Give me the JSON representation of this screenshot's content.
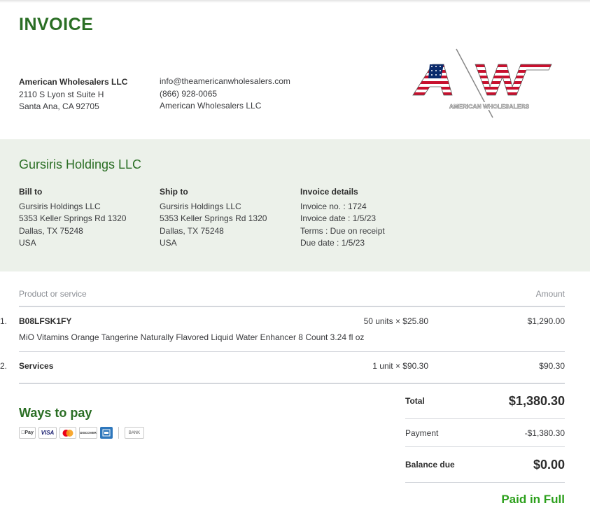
{
  "document": {
    "title": "INVOICE"
  },
  "company": {
    "name": "American Wholesalers LLC",
    "address1": "2110 S Lyon st Suite H",
    "address2": "Santa Ana, CA 92705",
    "email": "info@theamericanwholesalers.com",
    "phone": "(866) 928-0065",
    "website_name": "American Wholesalers LLC",
    "logo_text": "AMERICAN WHOLESALERS",
    "logo_letters": "AW"
  },
  "customer": {
    "name": "Gursiris Holdings LLC",
    "bill_to": {
      "heading": "Bill to",
      "lines": [
        "Gursiris Holdings LLC",
        "5353 Keller Springs Rd 1320",
        "Dallas, TX 75248",
        "USA"
      ]
    },
    "ship_to": {
      "heading": "Ship to",
      "lines": [
        "Gursiris Holdings LLC",
        "5353 Keller Springs Rd 1320",
        "Dallas, TX 75248",
        "USA"
      ]
    },
    "details": {
      "heading": "Invoice details",
      "lines": [
        "Invoice no. : 1724",
        "Invoice date : 1/5/23",
        "Terms : Due on receipt",
        "Due date : 1/5/23"
      ]
    }
  },
  "table": {
    "col_product": "Product or service",
    "col_amount": "Amount",
    "rows": [
      {
        "num": "1.",
        "sku": "B08LFSK1FY",
        "qty": "50 units × $25.80",
        "amount": "$1,290.00",
        "description": "MiO Vitamins Orange Tangerine Naturally Flavored Liquid Water Enhancer 8 Count 3.24 fl oz"
      },
      {
        "num": "2.",
        "sku": "Services",
        "qty": "1 unit × $90.30",
        "amount": "$90.30",
        "description": ""
      }
    ]
  },
  "payment": {
    "heading": "Ways to pay",
    "methods": [
      "Pay",
      "VISA",
      "DISCOVER",
      "BANK"
    ]
  },
  "totals": {
    "total_label": "Total",
    "total_value": "$1,380.30",
    "payment_label": "Payment",
    "payment_value": "-$1,380.30",
    "balance_label": "Balance due",
    "balance_value": "$0.00",
    "status": "Paid in Full"
  },
  "colors": {
    "brand_green": "#2a6e24",
    "band": "#ecf1ea",
    "paid_green": "#2ca01c",
    "flag_red": "#c8102e",
    "flag_blue": "#0a2a6b"
  }
}
